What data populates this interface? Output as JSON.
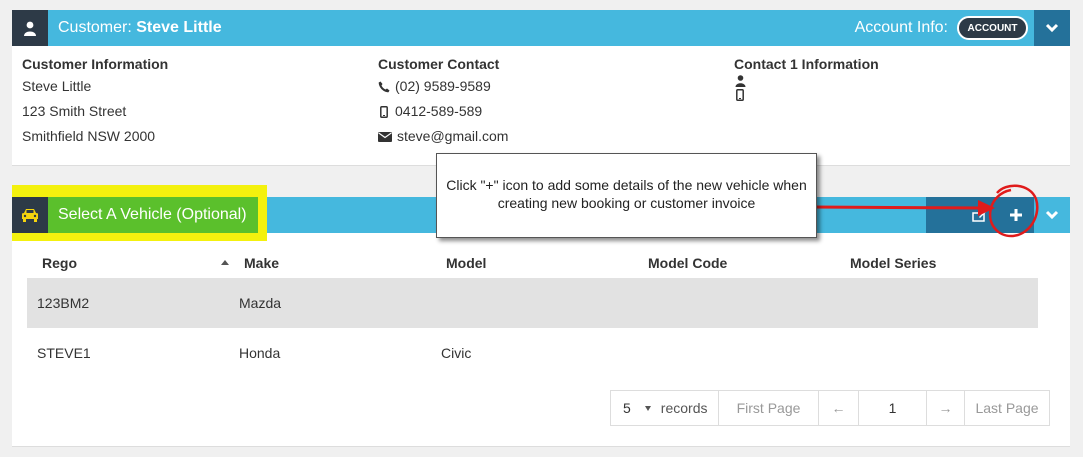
{
  "customer": {
    "label": "Customer:",
    "name": "Steve Little",
    "account_label": "Account Info:",
    "account_button": "ACCOUNT",
    "info": {
      "heading": "Customer Information",
      "lines": [
        "Steve Little",
        "123 Smith Street",
        "Smithfield NSW 2000"
      ]
    },
    "contact": {
      "heading": "Customer Contact",
      "phone": "(02) 9589-9589",
      "mobile": "0412-589-589",
      "email": "steve@gmail.com"
    },
    "contact1": {
      "heading": "Contact 1 Information"
    }
  },
  "vehicle": {
    "title": "Select A Vehicle (Optional)",
    "columns": [
      "Rego",
      "Make",
      "Model",
      "Model Code",
      "Model Series"
    ],
    "rows": [
      {
        "rego": "123BM2",
        "make": "Mazda",
        "model": "",
        "model_code": "",
        "model_series": ""
      },
      {
        "rego": "STEVE1",
        "make": "Honda",
        "model": "Civic",
        "model_code": "",
        "model_series": ""
      }
    ],
    "pager": {
      "page_size": "5",
      "records_label": "records",
      "first": "First Page",
      "prev": "←",
      "page": "1",
      "next": "→",
      "last": "Last Page"
    }
  },
  "callout": {
    "text": "Click \"+\" icon to add some details of the new vehicle when creating new booking or customer invoice"
  },
  "icons": {
    "user": "user-icon",
    "chevron": "chevron-down-icon",
    "phone": "phone-icon",
    "mobile": "mobile-icon",
    "email": "envelope-icon",
    "car": "car-icon",
    "plus": "plus-icon",
    "edit": "edit-icon"
  },
  "colors": {
    "header_blue": "#45b8de",
    "dark_navy": "#2d3a47",
    "dark_blue": "#24719a",
    "highlight_yellow": "#f4f10e",
    "title_green": "#5bc02c",
    "annotation_red": "#e01b1b"
  }
}
